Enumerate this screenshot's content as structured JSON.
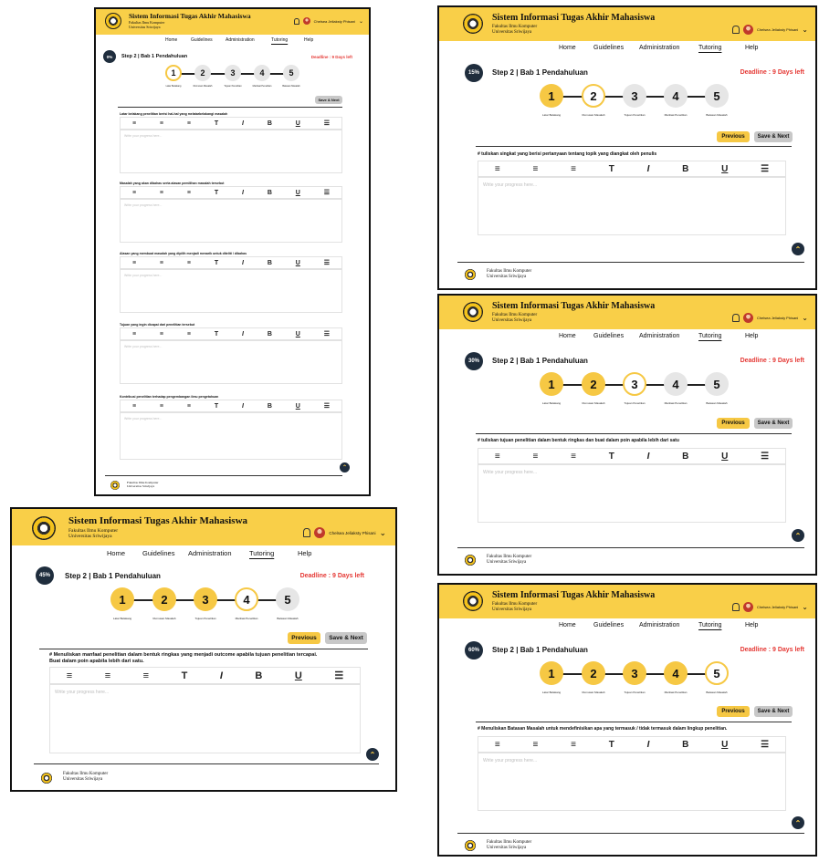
{
  "header": {
    "app_title": "Sistem Informasi Tugas Akhir Mahasiswa",
    "faculty": "Fakultas Ilmu Komputer",
    "university": "Universitas Sriwijaya",
    "user_name": "Chelsea Jeliaksty Phisani",
    "chevron": "chevron-down-icon"
  },
  "nav": {
    "home": "Home",
    "guidelines": "Guidelines",
    "administration": "Administration",
    "tutoring": "Tutoring",
    "help": "Help"
  },
  "footer": {
    "faculty": "Fakultas Ilmu Komputer",
    "university": "Universitas Sriwijaya"
  },
  "steps": [
    "1",
    "2",
    "3",
    "4",
    "5"
  ],
  "step_labels": [
    "Latar Belakang",
    "Rumusan Masalah",
    "Tujuan Penelitian",
    "Manfaat Penelitian",
    "Batasan Masalah"
  ],
  "toolbar": [
    "≡",
    "≡",
    "≡",
    "T",
    "I",
    "B",
    "U",
    "☰"
  ],
  "buttons": {
    "previous": "Previous",
    "save_next": "Save & Next"
  },
  "placeholder": "Write your progress here...",
  "colors": {
    "header": "#f9cf48",
    "accent": "#f6c844",
    "deadline": "#e53935",
    "dark": "#1f2d3d"
  },
  "screens": [
    {
      "progress": "0%",
      "step_title": "Step 2 | Bab 1 Pendahuluan",
      "deadline": "Deadline : 9 Days left",
      "current_step": 1,
      "questions": [
        "Latar belakang penelitian berisi hal-hal yang melatarbelakangi masalah",
        "Masalah yang akan dibahas serta alasan pemilihan masalah tersebut",
        "Alasan yang membuat masalah yang dipilih menjadi menarik untuk diteliti / dibahas",
        "Tujuan yang ingin dicapai dari penelitian tersebut",
        "Kontribusi penelitian terhadap pengembangan ilmu pengetahuan"
      ]
    },
    {
      "progress": "15%",
      "step_title": "Step 2 | Bab 1 Pendahuluan",
      "deadline": "Deadline : 9 Days left",
      "current_step": 2,
      "question": "# tuliskan singkat yang berisi pertanyaan tentang topik yang diangkat oleh penulis"
    },
    {
      "progress": "30%",
      "step_title": "Step 2 | Bab 1 Pendahuluan",
      "deadline": "Deadline : 9 Days left",
      "current_step": 3,
      "question": "# tuliskan tujuan penelitian dalam bentuk ringkas dan buat dalam poin apabila lebih dari satu"
    },
    {
      "progress": "45%",
      "step_title": "Step 2 | Bab 1 Pendahuluan",
      "deadline": "Deadline : 9 Days left",
      "current_step": 4,
      "question": "# Menuliskan manfaat penelitian dalam bentuk ringkas yang menjadi outcome apabila tujuan penelitian tercapai.",
      "question2": "Buat dalam poin apabila lebih dari satu."
    },
    {
      "progress": "60%",
      "step_title": "Step 2 | Bab 1 Pendahuluan",
      "deadline": "Deadline : 9 Days left",
      "current_step": 5,
      "question": "# Menuliskan Batasan Masalah untuk mendefinisikan apa yang termasuk / tidak termasuk dalam lingkup penelitian."
    }
  ]
}
